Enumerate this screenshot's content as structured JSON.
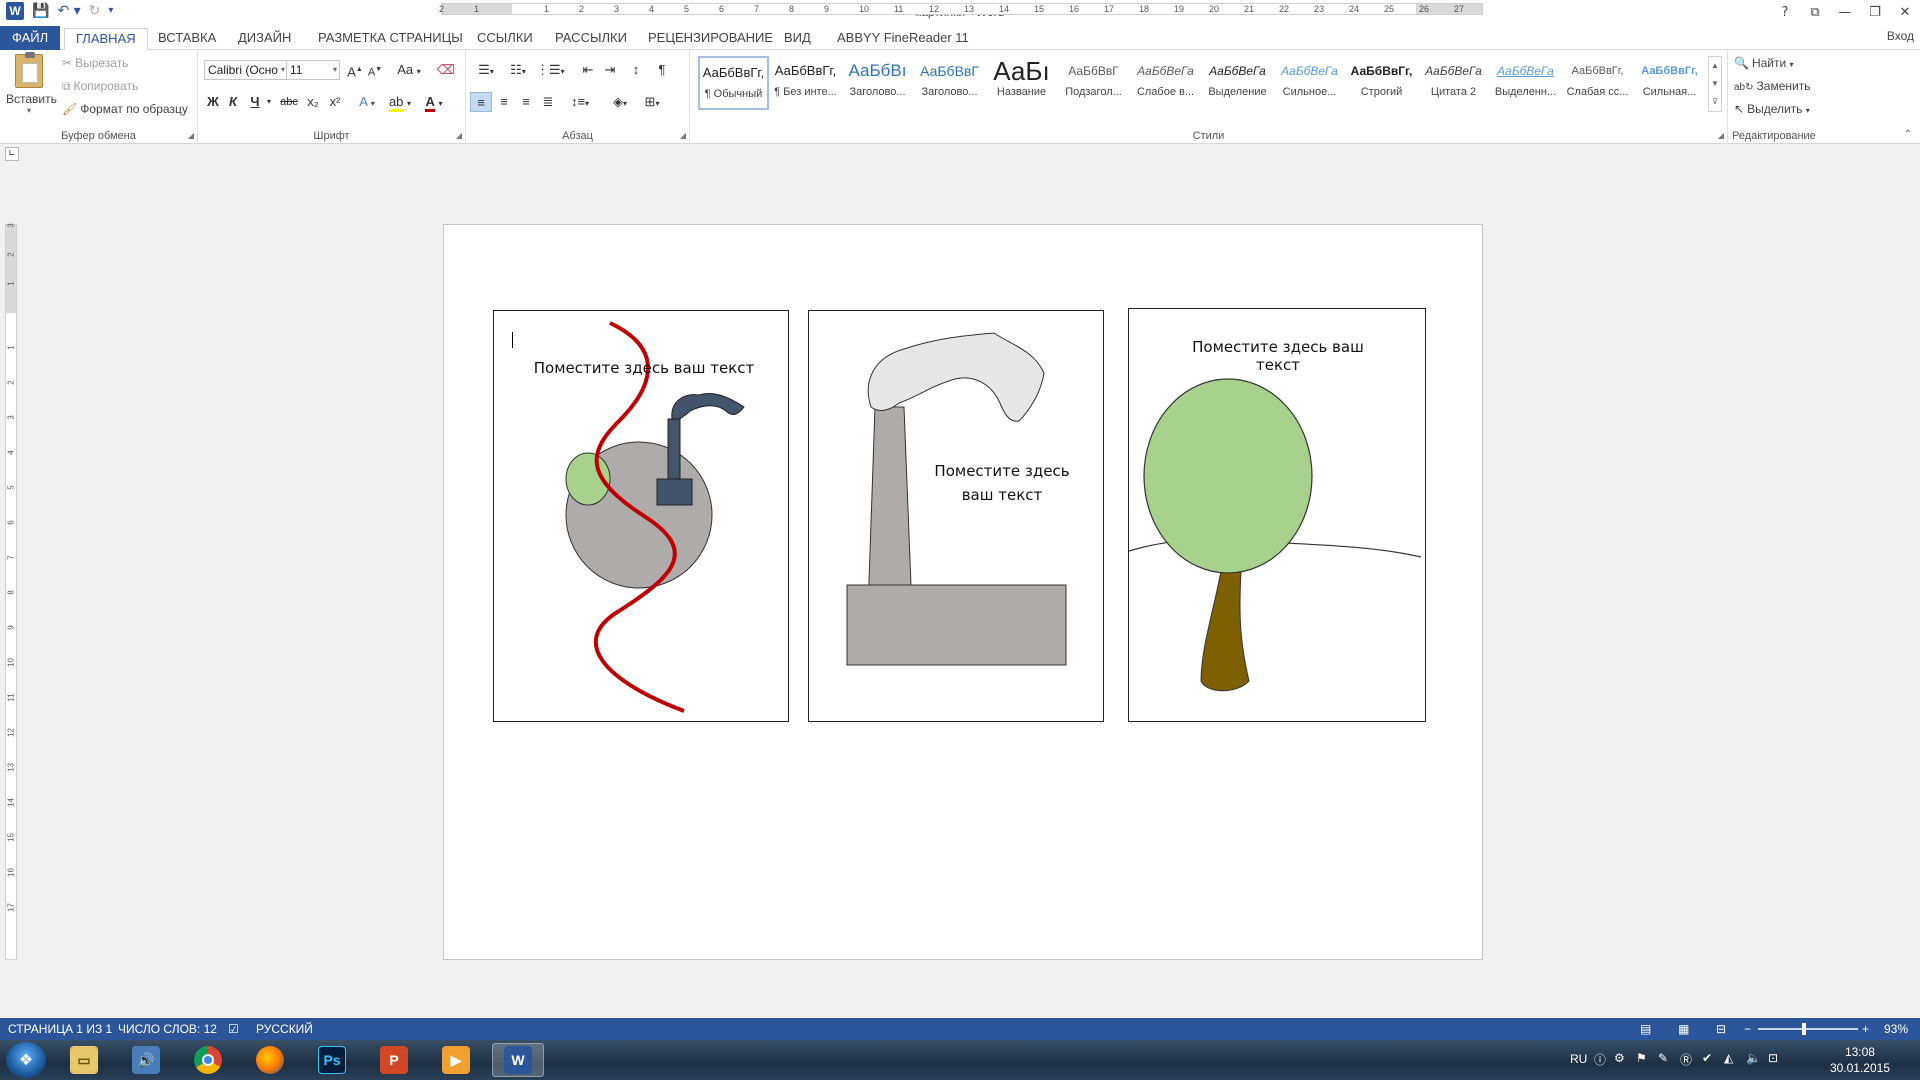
{
  "window": {
    "title": "картинки - Word",
    "controls": [
      "?",
      "⧉",
      "—",
      "❐",
      "✕"
    ],
    "sign_in": "Вход"
  },
  "tabs": [
    {
      "label": "ФАЙЛ"
    },
    {
      "label": "ГЛАВНАЯ"
    },
    {
      "label": "ВСТАВКА"
    },
    {
      "label": "ДИЗАЙН"
    },
    {
      "label": "РАЗМЕТКА СТРАНИЦЫ"
    },
    {
      "label": "ССЫЛКИ"
    },
    {
      "label": "РАССЫЛКИ"
    },
    {
      "label": "РЕЦЕНЗИРОВАНИЕ"
    },
    {
      "label": "ВИД"
    },
    {
      "label": "ABBYY FineReader 11"
    }
  ],
  "clipboard": {
    "paste": "Вставить",
    "cut": "Вырезать",
    "copy": "Копировать",
    "format_painter": "Формат по образцу",
    "group_label": "Буфер обмена"
  },
  "font": {
    "name": "Calibri (Осно",
    "size": "11",
    "bold": "Ж",
    "italic": "К",
    "underline": "Ч",
    "strike": "abc",
    "subscript": "x₂",
    "superscript": "x²",
    "grow": "A",
    "shrink": "A",
    "case": "Aa",
    "group_label": "Шрифт"
  },
  "paragraph": {
    "group_label": "Абзац",
    "pilcrow": "¶"
  },
  "styles": {
    "group_label": "Стили",
    "items": [
      {
        "preview": "АаБбВвГг,",
        "name": "¶ Обычный"
      },
      {
        "preview": "АаБбВвГг,",
        "name": "¶ Без инте..."
      },
      {
        "preview": "АаБбВı",
        "name": "Заголово..."
      },
      {
        "preview": "АаБбВвГ",
        "name": "Заголово..."
      },
      {
        "preview": "АаБı",
        "name": "Название"
      },
      {
        "preview": "АаБбВвГ",
        "name": "Подзагол..."
      },
      {
        "preview": "АаБбВеГа",
        "name": "Слабое в..."
      },
      {
        "preview": "АаБбВеГа",
        "name": "Выделение"
      },
      {
        "preview": "АаБбВеГа",
        "name": "Сильное..."
      },
      {
        "preview": "АаБбВвГг,",
        "name": "Строгий"
      },
      {
        "preview": "АаБбВеГа",
        "name": "Цитата 2"
      },
      {
        "preview": "АаБбВеГа",
        "name": "Выделенн..."
      },
      {
        "preview": "АаБбВвГг,",
        "name": "Слабая сс..."
      },
      {
        "preview": "АаБбВвГг,",
        "name": "Сильная..."
      }
    ]
  },
  "editing": {
    "find": "Найти",
    "replace": "Заменить",
    "select": "Выделить",
    "group_label": "Редактирование"
  },
  "ruler": {
    "ticks": [
      "2",
      "1",
      "1",
      "2",
      "3",
      "4",
      "5",
      "6",
      "7",
      "8",
      "9",
      "10",
      "11",
      "12",
      "13",
      "14",
      "15",
      "16",
      "17",
      "18",
      "19",
      "20",
      "21",
      "22",
      "23",
      "24",
      "25",
      "26",
      "27"
    ],
    "vticks": [
      "3",
      "2",
      "1",
      "1",
      "2",
      "3",
      "4",
      "5",
      "6",
      "7",
      "8",
      "9",
      "10",
      "11",
      "12",
      "13",
      "14",
      "15",
      "16",
      "17"
    ]
  },
  "document": {
    "card1_text": "Поместите здесь  ваш текст",
    "card2_text_line1": "Поместите здесь",
    "card2_text_line2": "ваш текст",
    "card3_text": "Поместите здесь  ваш текст",
    "colors": {
      "river": "#c00000",
      "hill": "#afabab",
      "factory_dark": "#44546a",
      "crown": "#a9d18e",
      "trunk": "#7f6000",
      "smoke": "#e7e6e6",
      "chimney": "#afabab"
    }
  },
  "statusbar": {
    "page": "СТРАНИЦА 1 ИЗ 1",
    "words": "ЧИСЛО СЛОВ: 12",
    "language": "РУССКИЙ",
    "zoom": "93%"
  },
  "taskbar": {
    "apps": [
      "start",
      "explorer",
      "media",
      "chrome",
      "firefox",
      "photoshop",
      "powerpoint",
      "player",
      "word"
    ],
    "lang": "RU",
    "time": "13:08",
    "date": "30.01.2015"
  }
}
